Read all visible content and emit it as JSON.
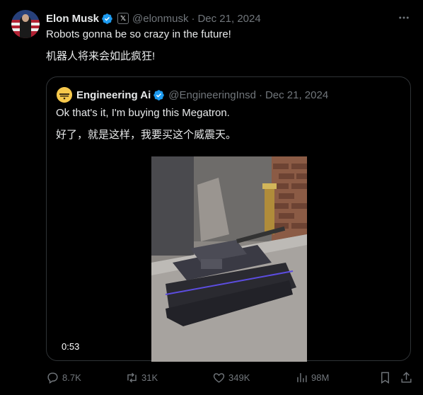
{
  "tweet": {
    "name": "Elon Musk",
    "handle": "@elonmusk",
    "separator": "·",
    "date": "Dec 21, 2024",
    "text_en": "Robots gonna be so crazy in the future!",
    "text_zh": "机器人将来会如此疯狂!"
  },
  "quote": {
    "name": "Engineering Ai",
    "handle": "@EngineeringInsd",
    "separator": "·",
    "date": "Dec 21, 2024",
    "text_en": "Ok that's it, I'm buying this Megatron.",
    "text_zh": "好了，就是这样，我要买这个威震天。",
    "video_duration": "0:53"
  },
  "actions": {
    "replies": "8.7K",
    "reposts": "31K",
    "likes": "349K",
    "views": "98M"
  },
  "colors": {
    "background": "#000000",
    "text": "#e7e9ea",
    "muted": "#71767b",
    "verified": "#1d9bf0",
    "border": "#2f3336"
  }
}
